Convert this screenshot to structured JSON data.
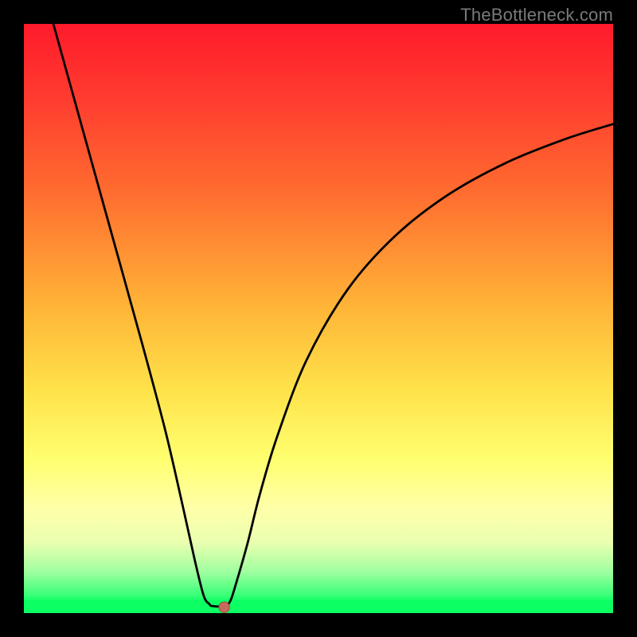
{
  "watermark": "TheBottleneck.com",
  "colors": {
    "frame": "#000000",
    "curve": "#000000",
    "marker_fill": "#c96a5f",
    "marker_stroke": "#a04a40"
  },
  "chart_data": {
    "type": "line",
    "title": "",
    "xlabel": "",
    "ylabel": "",
    "xlim": [
      0,
      100
    ],
    "ylim": [
      0,
      100
    ],
    "grid": false,
    "legend": false,
    "series": [
      {
        "name": "curve",
        "x": [
          5,
          10,
          15,
          20,
          24,
          27,
          29,
          30.5,
          31.5,
          32,
          34,
          35,
          36,
          38,
          40,
          43,
          48,
          55,
          63,
          72,
          82,
          92,
          100
        ],
        "y": [
          100,
          82,
          64,
          46,
          31,
          18,
          9,
          3,
          1.5,
          1.2,
          1.2,
          2,
          5,
          12,
          20,
          30,
          43,
          55,
          64,
          71,
          76.5,
          80.5,
          83
        ]
      }
    ],
    "marker": {
      "x": 34,
      "y": 1.0,
      "r": 0.9
    },
    "note": "x,y are percentages of the plotting area; y=0 at bottom, 100 at top. Values estimated from pixels."
  }
}
